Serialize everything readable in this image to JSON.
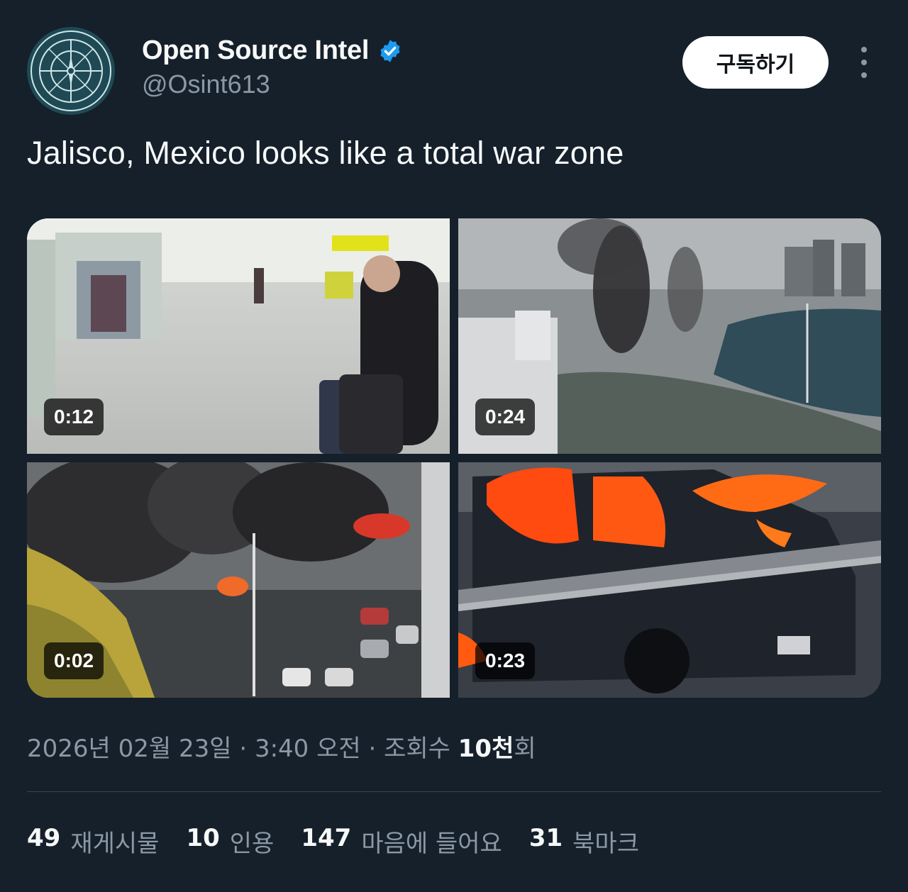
{
  "author": {
    "display_name": "Open Source Intel",
    "handle": "@Osint613",
    "avatar_icon": "compass-emblem-icon",
    "verified_icon": "verified-badge-icon",
    "verified_color": "#1d9bf0"
  },
  "header": {
    "subscribe_label": "구독하기",
    "more_icon": "vertical-ellipsis-icon"
  },
  "tweet": {
    "text": "Jalisco, Mexico looks like a total war zone"
  },
  "media": [
    {
      "duration": "0:12"
    },
    {
      "duration": "0:24"
    },
    {
      "duration": "0:02"
    },
    {
      "duration": "0:23"
    }
  ],
  "meta": {
    "date": "2026년 02월 23일",
    "sep1": " · ",
    "time": "3:40 오전",
    "sep2": " · ",
    "views_label": "조회수 ",
    "views_count": "10천",
    "views_suffix": "회"
  },
  "stats": {
    "reposts_count": "49",
    "reposts_label": "재게시물",
    "quotes_count": "10",
    "quotes_label": "인용",
    "likes_count": "147",
    "likes_label": "마음에 들어요",
    "bookmarks_count": "31",
    "bookmarks_label": "북마크"
  },
  "colors": {
    "background": "#15202b",
    "primary_text": "#f7f9f9",
    "secondary_text": "#8b98a5",
    "divider": "#38444d"
  }
}
